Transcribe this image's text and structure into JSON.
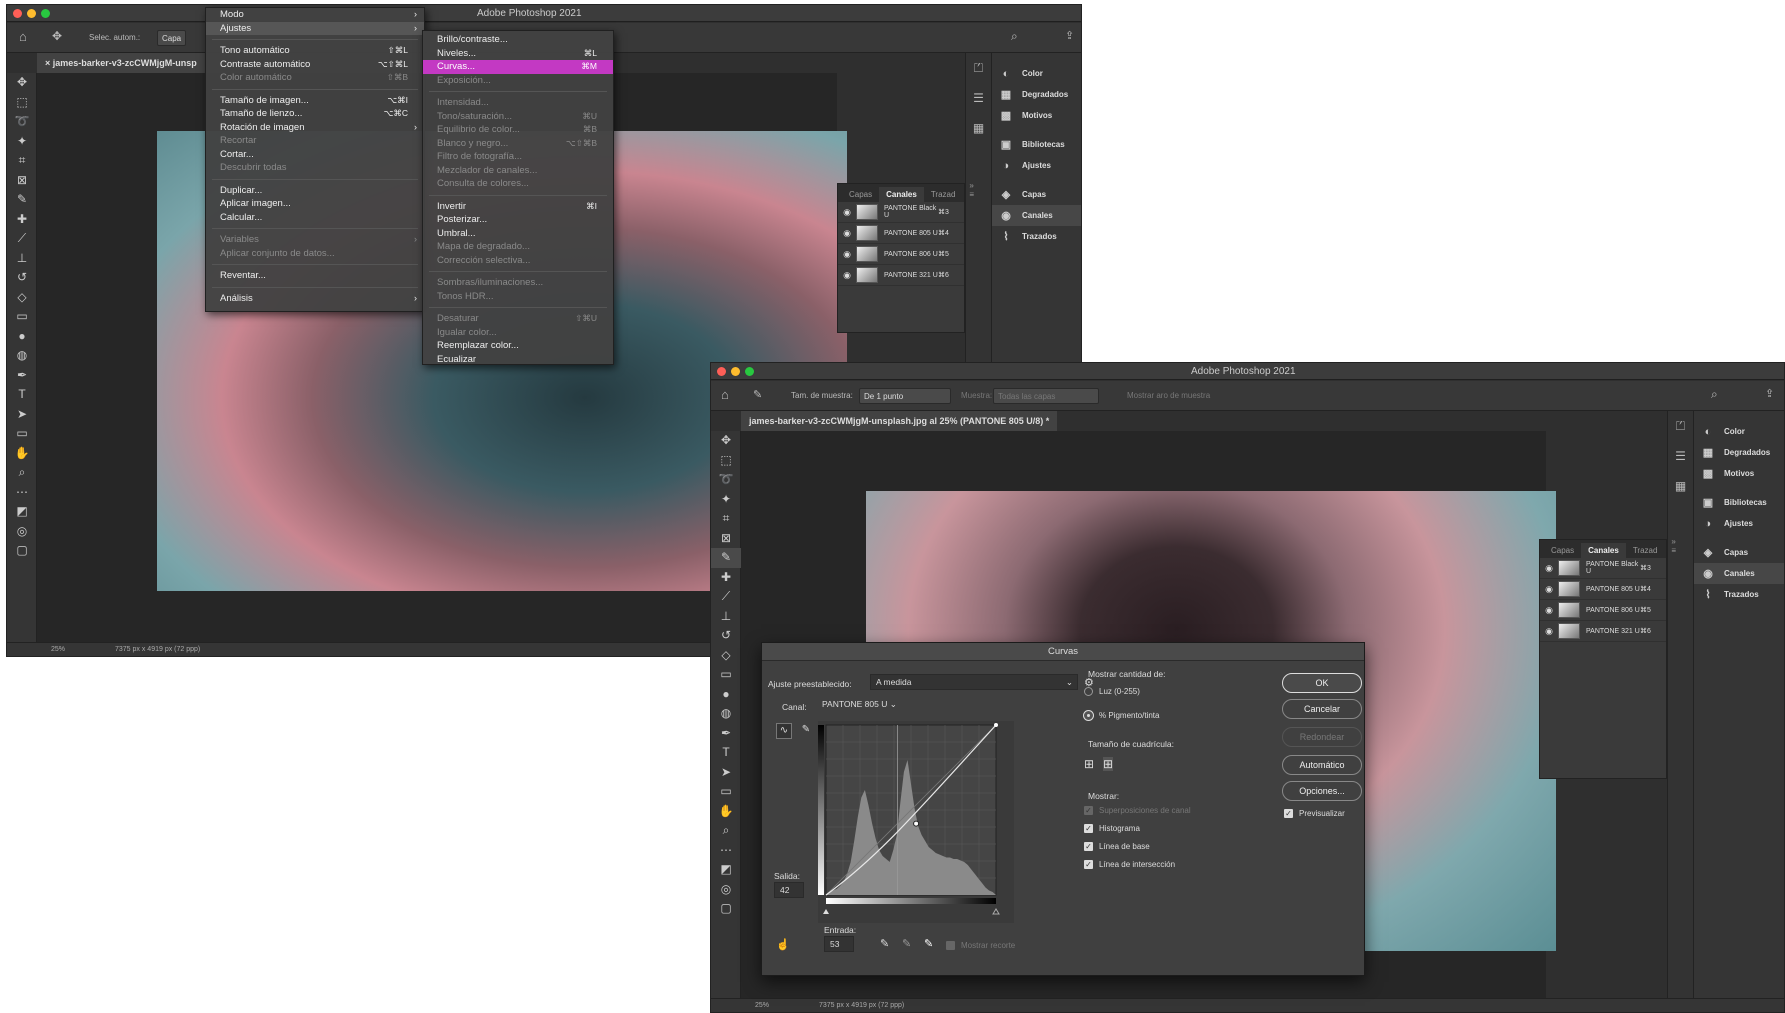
{
  "app_title": "Adobe Photoshop 2021",
  "colors": {
    "accent_menu": "#c339c3",
    "close": "#fe5f57",
    "minimize": "#febc2e",
    "maximize": "#28c840"
  },
  "w1": {
    "options": {
      "auto_select_label": "Selec. autom.:",
      "auto_select_value": "Capa"
    },
    "doc_tab": "× james-barker-v3-zcCWMjgM-unsp",
    "status": {
      "zoom": "25%",
      "size": "7375 px x 4919 px (72 ppp)"
    },
    "main_menu": [
      {
        "label": "Modo",
        "arrow": "›"
      },
      {
        "label": "Ajustes",
        "arrow": "›"
      },
      {
        "sep": true
      },
      {
        "label": "Tono automático",
        "sc": "⇧⌘L"
      },
      {
        "label": "Contraste automático",
        "sc": "⌥⇧⌘L"
      },
      {
        "label": "Color automático",
        "sc": "⇧⌘B",
        "dis": true
      },
      {
        "sep": true
      },
      {
        "label": "Tamaño de imagen...",
        "sc": "⌥⌘I"
      },
      {
        "label": "Tamaño de lienzo...",
        "sc": "⌥⌘C"
      },
      {
        "label": "Rotación de imagen",
        "arrow": "›"
      },
      {
        "label": "Recortar",
        "dis": true
      },
      {
        "label": "Cortar..."
      },
      {
        "label": "Descubrir todas",
        "dis": true
      },
      {
        "sep": true
      },
      {
        "label": "Duplicar..."
      },
      {
        "label": "Aplicar imagen..."
      },
      {
        "label": "Calcular..."
      },
      {
        "sep": true
      },
      {
        "label": "Variables",
        "arrow": "›",
        "dis": true
      },
      {
        "label": "Aplicar conjunto de datos...",
        "dis": true
      },
      {
        "sep": true
      },
      {
        "label": "Reventar..."
      },
      {
        "sep": true
      },
      {
        "label": "Análisis",
        "arrow": "›"
      }
    ],
    "sub_menu": [
      {
        "label": "Brillo/contraste..."
      },
      {
        "label": "Niveles...",
        "sc": "⌘L"
      },
      {
        "label": "Curvas...",
        "sc": "⌘M",
        "hl": true
      },
      {
        "label": "Exposición...",
        "dis": true
      },
      {
        "sep": true
      },
      {
        "label": "Intensidad...",
        "dis": true
      },
      {
        "label": "Tono/saturación...",
        "sc": "⌘U",
        "dis": true
      },
      {
        "label": "Equilibrio de color...",
        "sc": "⌘B",
        "dis": true
      },
      {
        "label": "Blanco y negro...",
        "sc": "⌥⇧⌘B",
        "dis": true
      },
      {
        "label": "Filtro de fotografía...",
        "dis": true
      },
      {
        "label": "Mezclador de canales...",
        "dis": true
      },
      {
        "label": "Consulta de colores...",
        "dis": true
      },
      {
        "sep": true
      },
      {
        "label": "Invertir",
        "sc": "⌘I"
      },
      {
        "label": "Posterizar..."
      },
      {
        "label": "Umbral..."
      },
      {
        "label": "Mapa de degradado...",
        "dis": true
      },
      {
        "label": "Corrección selectiva...",
        "dis": true
      },
      {
        "sep": true
      },
      {
        "label": "Sombras/iluminaciones...",
        "dis": true
      },
      {
        "label": "Tonos HDR...",
        "dis": true
      },
      {
        "sep": true
      },
      {
        "label": "Desaturar",
        "sc": "⇧⌘U",
        "dis": true
      },
      {
        "label": "Igualar color...",
        "dis": true
      },
      {
        "label": "Reemplazar color..."
      },
      {
        "label": "Ecualizar"
      }
    ]
  },
  "panels": {
    "items": [
      {
        "icon": "◐",
        "label": "Color"
      },
      {
        "icon": "▦",
        "label": "Degradados"
      },
      {
        "icon": "▩",
        "label": "Motivos"
      },
      {
        "icon": "▣",
        "label": "Bibliotecas"
      },
      {
        "icon": "◑",
        "label": "Ajustes"
      },
      {
        "icon": "◈",
        "label": "Capas"
      },
      {
        "icon": "◉",
        "label": "Canales"
      },
      {
        "icon": "⌇",
        "label": "Trazados"
      }
    ],
    "channel_tabs": [
      "Capas",
      "Canales",
      "Trazad"
    ],
    "channels": [
      {
        "name": "PANTONE Black U",
        "sc": "⌘3"
      },
      {
        "name": "PANTONE 805 U",
        "sc": "⌘4"
      },
      {
        "name": "PANTONE 806 U",
        "sc": "⌘5"
      },
      {
        "name": "PANTONE 321 U",
        "sc": "⌘6"
      }
    ]
  },
  "w2": {
    "options": {
      "sample_size_label": "Tam. de muestra:",
      "sample_size_value": "De 1 punto",
      "sample_label": "Muestra:",
      "sample_value": "Todas las capas",
      "ring_label": "Mostrar aro de muestra"
    },
    "doc_tab": "james-barker-v3-zcCWMjgM-unsplash.jpg al 25% (PANTONE 805 U/8) *",
    "status": {
      "zoom": "25%",
      "size": "7375 px x 4919 px (72 ppp)"
    }
  },
  "curves": {
    "title": "Curvas",
    "preset_label": "Ajuste preestablecido:",
    "preset_value": "A medida",
    "channel_label": "Canal:",
    "channel_value": "PANTONE 805 U",
    "output_label": "Salida:",
    "output_value": "42",
    "input_label": "Entrada:",
    "input_value": "53",
    "show_clipping": "Mostrar recorte",
    "show_amount_label": "Mostrar cantidad de:",
    "light_option": "Luz (0-255)",
    "pigment_option": "% Pigmento/tinta",
    "grid_size_label": "Tamaño de cuadrícula:",
    "show_label": "Mostrar:",
    "show_options": [
      {
        "label": "Superposiciones de canal",
        "checked": true,
        "dis": true
      },
      {
        "label": "Histograma",
        "checked": true
      },
      {
        "label": "Línea de base",
        "checked": true
      },
      {
        "label": "Línea de intersección",
        "checked": true
      }
    ],
    "buttons": {
      "ok": "OK",
      "cancel": "Cancelar",
      "smooth": "Redondear",
      "auto": "Automático",
      "options": "Opciones..."
    },
    "preview_label": "Previsualizar"
  }
}
